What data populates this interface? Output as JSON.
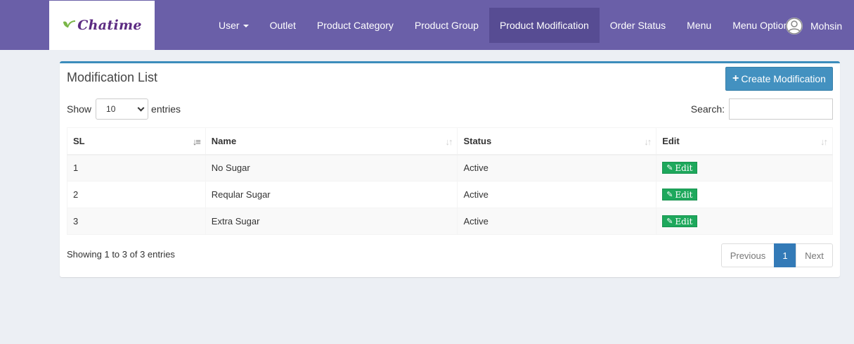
{
  "brand": {
    "name": "Chatime",
    "logo_icon": "chatime-leaf-icon",
    "color": "#5c2b82"
  },
  "nav": {
    "items": [
      {
        "label": "User",
        "dropdown": true
      },
      {
        "label": "Outlet"
      },
      {
        "label": "Product Category"
      },
      {
        "label": "Product Group"
      },
      {
        "label": "Product Modification",
        "active": true
      },
      {
        "label": "Order Status"
      },
      {
        "label": "Menu"
      },
      {
        "label": "Menu Option"
      }
    ],
    "user_name": "Mohsin",
    "user_icon": "user-avatar-icon",
    "bar_color": "#6a5fa8"
  },
  "page": {
    "title": "Modification List",
    "create_button_label": "Create Modification",
    "show_label": "Show",
    "entries_label": "entries",
    "page_length": "10",
    "search_label": "Search:",
    "search_value": ""
  },
  "table": {
    "columns": [
      "SL",
      "Name",
      "Status",
      "Edit"
    ],
    "rows": [
      {
        "sl": "1",
        "name": "No Sugar",
        "status": "Active",
        "edit": "Edit"
      },
      {
        "sl": "2",
        "name": "Reqular Sugar",
        "status": "Active",
        "edit": "Edit"
      },
      {
        "sl": "3",
        "name": "Extra Sugar",
        "status": "Active",
        "edit": "Edit"
      }
    ]
  },
  "footer": {
    "info": "Showing 1 to 3 of 3 entries",
    "previous": "Previous",
    "current_page": "1",
    "next": "Next"
  }
}
